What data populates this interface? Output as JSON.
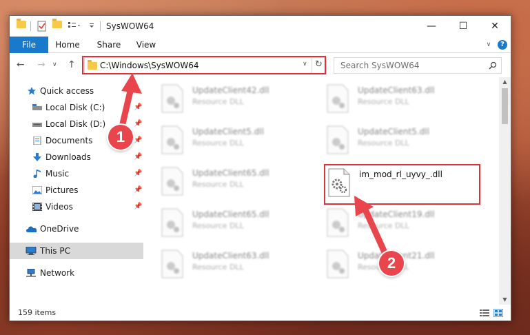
{
  "window": {
    "title": "SysWOW64",
    "minimize": "—",
    "maximize": "☐",
    "close": "✕"
  },
  "ribbon": {
    "tabs": [
      "File",
      "Home",
      "Share",
      "View"
    ]
  },
  "address": {
    "path": "C:\\Windows\\SysWOW64",
    "search_placeholder": "Search SysWOW64"
  },
  "navpane": {
    "quick_access": "Quick access",
    "items": [
      {
        "label": "Local Disk (C:)",
        "icon": "drive-icon"
      },
      {
        "label": "Local Disk (D:)",
        "icon": "drive-icon"
      },
      {
        "label": "Documents",
        "icon": "documents-icon"
      },
      {
        "label": "Downloads",
        "icon": "downloads-icon"
      },
      {
        "label": "Music",
        "icon": "music-icon"
      },
      {
        "label": "Pictures",
        "icon": "pictures-icon"
      },
      {
        "label": "Videos",
        "icon": "videos-icon"
      }
    ],
    "onedrive": "OneDrive",
    "this_pc": "This PC",
    "network": "Network"
  },
  "files": [
    {
      "name": "UpdateClient42.dll",
      "type": "Resource DLL"
    },
    {
      "name": "UpdateClient63.dll",
      "type": "Resource DLL"
    },
    {
      "name": "UpdateClient5.dll",
      "type": "Resource DLL"
    },
    {
      "name": "UpdateClient5.dll",
      "type": "Resource DLL"
    },
    {
      "name": "UpdateClient65.dll",
      "type": "Resource DLL"
    },
    {
      "name": "im_mod_rl_uyvy_.dll",
      "type": ""
    },
    {
      "name": "UpdateClient65.dll",
      "type": "Resource DLL"
    },
    {
      "name": "UpdateClient19.dll",
      "type": "Resource DLL"
    },
    {
      "name": "UpdateClient63.dll",
      "type": "Resource DLL"
    },
    {
      "name": "UpdateClient21.dll",
      "type": "Resource DLL"
    }
  ],
  "status": {
    "items_count": "159 items"
  },
  "annotations": {
    "step1": "1",
    "step2": "2",
    "color": "#e0303a"
  },
  "colors": {
    "accent": "#1979ca",
    "selected": "#d9d9d9"
  }
}
